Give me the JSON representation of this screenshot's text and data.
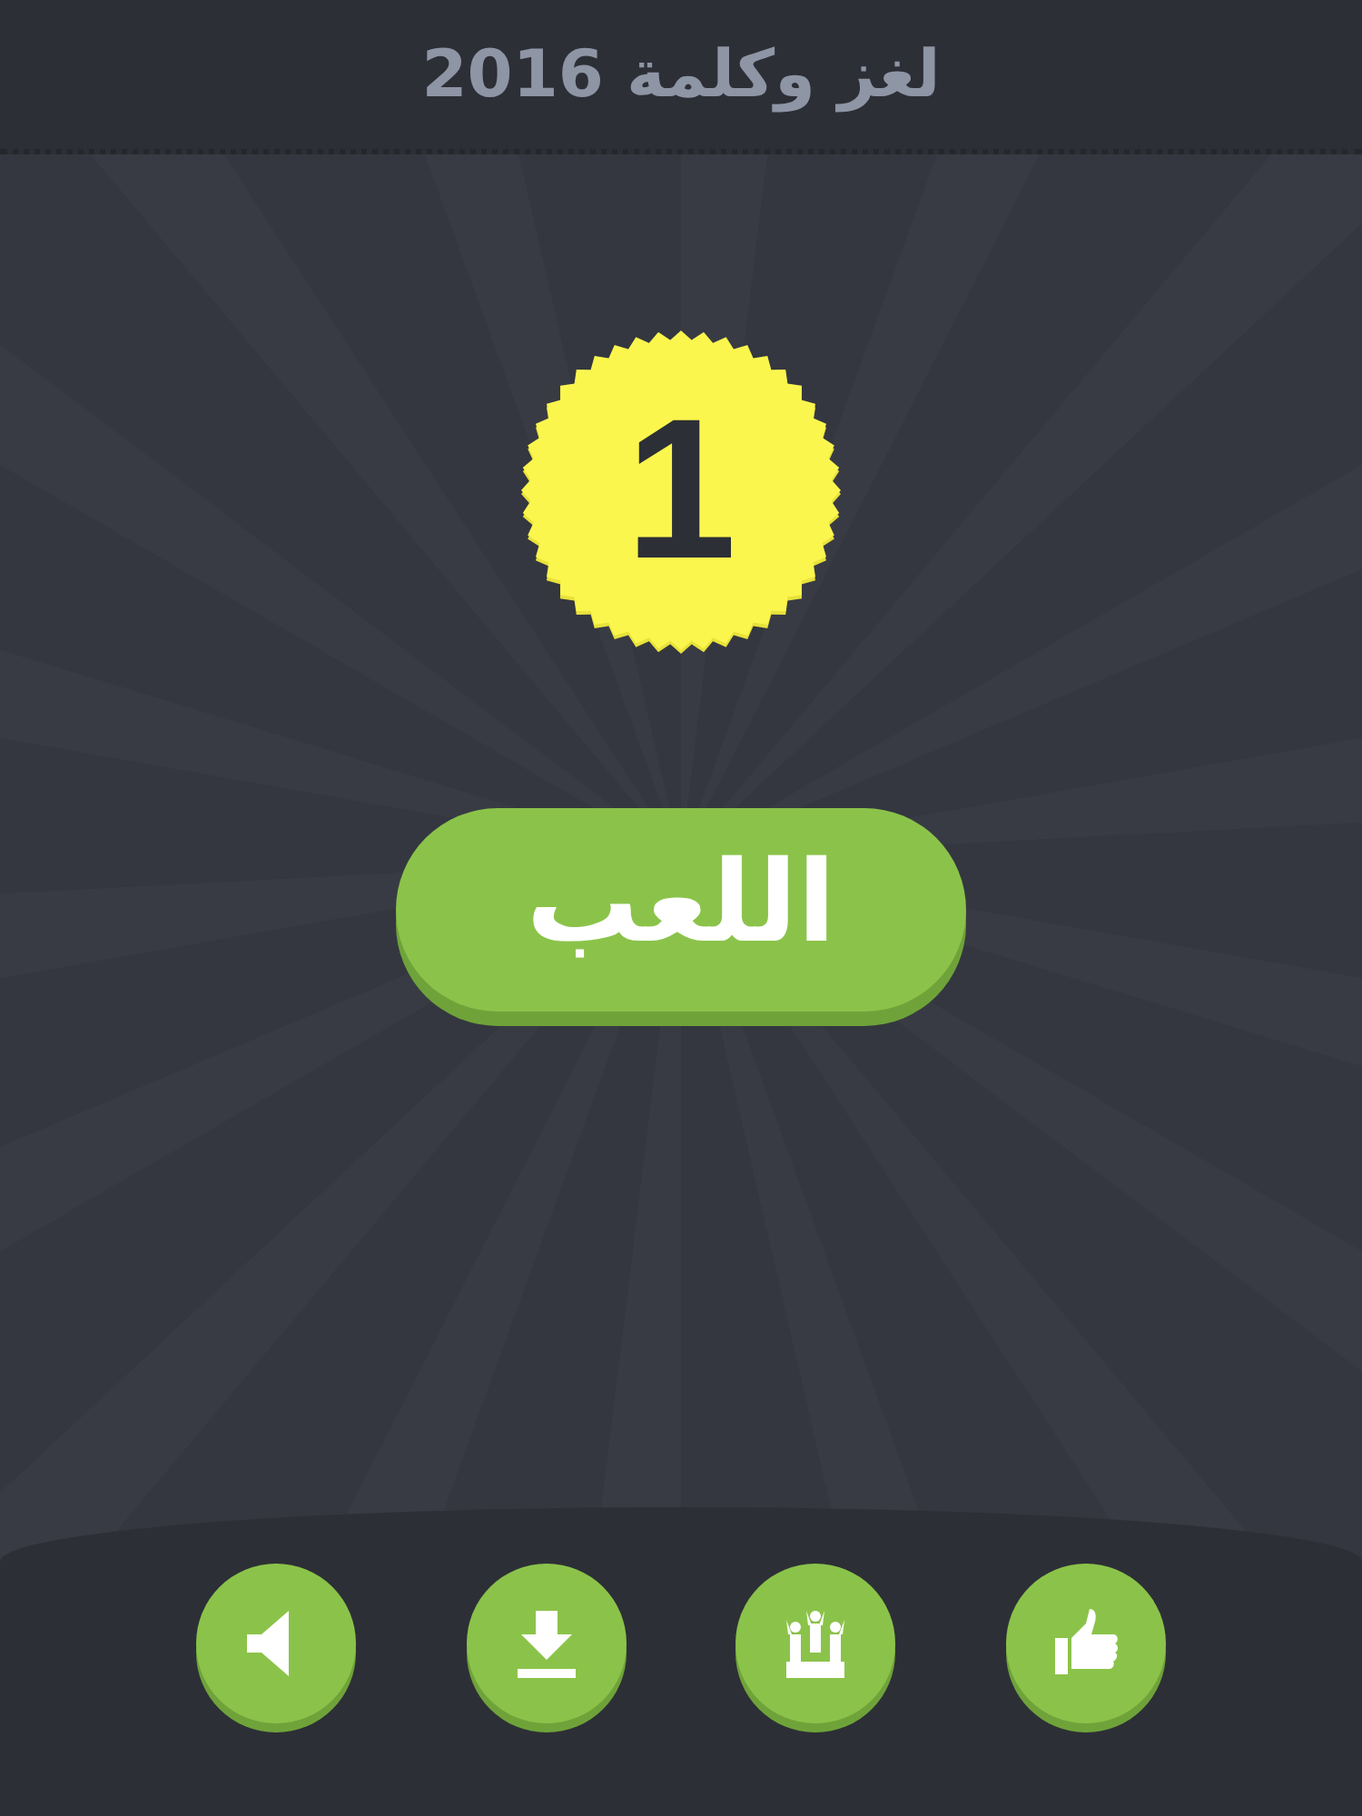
{
  "header": {
    "title": "لغز وكلمة 2016"
  },
  "level_badge": {
    "number": "1"
  },
  "play_button": {
    "label": "اللعب"
  },
  "bottom_buttons": [
    {
      "kind": "sound"
    },
    {
      "kind": "download"
    },
    {
      "kind": "leaderboard"
    },
    {
      "kind": "like"
    }
  ]
}
